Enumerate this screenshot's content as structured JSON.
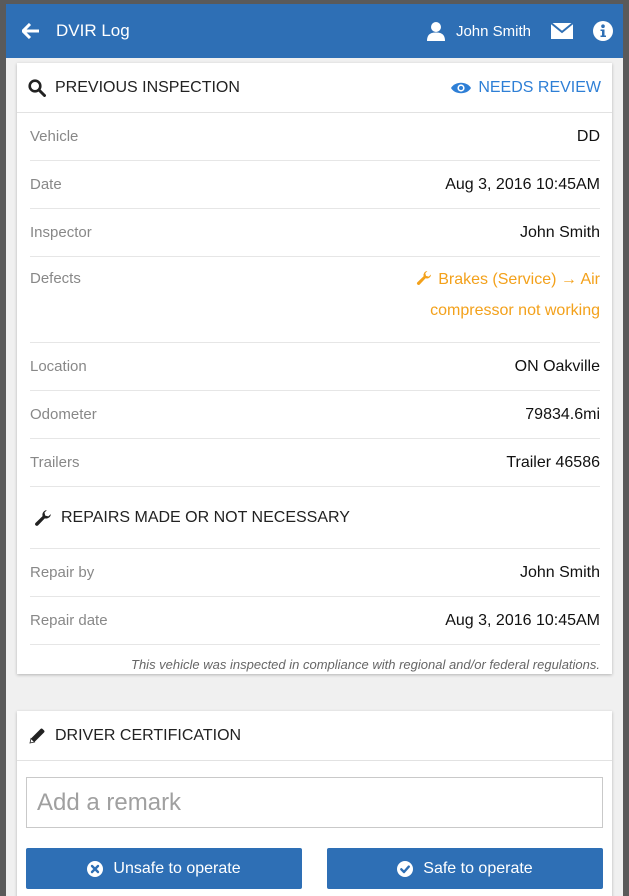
{
  "header": {
    "title": "DVIR Log",
    "user_name": "John Smith",
    "bar_color": "#2e6fb5"
  },
  "inspection": {
    "title": "PREVIOUS INSPECTION",
    "status": "NEEDS REVIEW",
    "status_color": "#2e7fd6",
    "rows": [
      {
        "label": "Vehicle",
        "value": "DD"
      },
      {
        "label": "Date",
        "value": "Aug 3, 2016 10:45AM"
      },
      {
        "label": "Inspector",
        "value": "John Smith"
      }
    ],
    "defects": {
      "label": "Defects",
      "line1": "Brakes (Service) → Air",
      "line2": "compressor not working",
      "color": "#f3a11b"
    },
    "rows2": [
      {
        "label": "Location",
        "value": "ON Oakville"
      },
      {
        "label": "Odometer",
        "value": "79834.6mi"
      },
      {
        "label": "Trailers",
        "value": "Trailer 46586"
      }
    ],
    "repairs": {
      "title": "REPAIRS MADE OR NOT NECESSARY",
      "rows": [
        {
          "label": "Repair by",
          "value": "John Smith"
        },
        {
          "label": "Repair date",
          "value": "Aug 3, 2016 10:45AM"
        }
      ]
    },
    "compliance_note": "This vehicle was inspected in compliance with regional and/or federal regulations."
  },
  "certification": {
    "title": "DRIVER CERTIFICATION",
    "remark_placeholder": "Add a remark",
    "unsafe_label": "Unsafe to operate",
    "safe_label": "Safe to operate"
  }
}
